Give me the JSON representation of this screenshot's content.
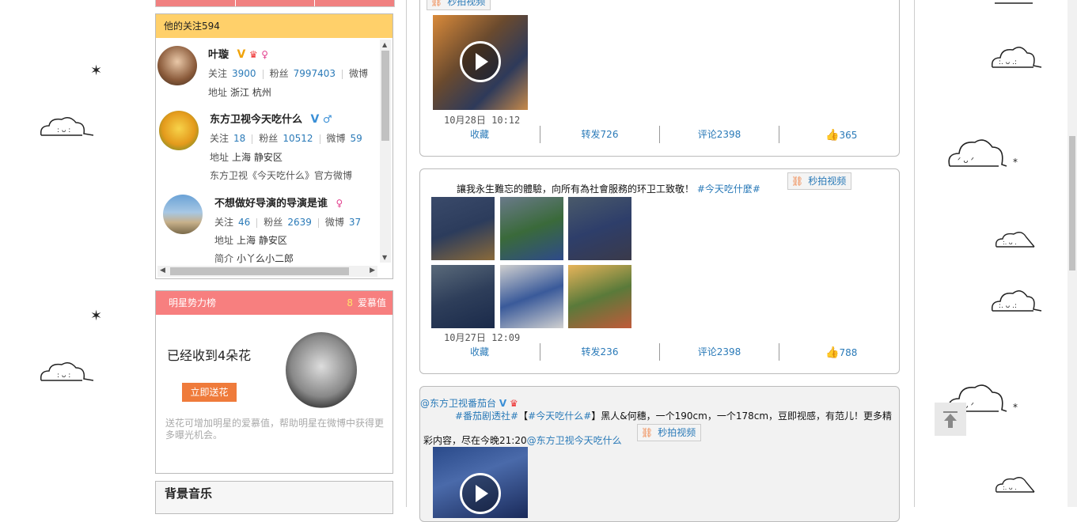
{
  "left": {
    "following": {
      "header": "他的关注594",
      "items": [
        {
          "name": "叶璇",
          "follow_label": "关注",
          "follow": "3900",
          "fans_label": "粉丝",
          "fans": "7997403",
          "weibo_label": "微博",
          "addr_label": "地址",
          "addr": "浙江 杭州"
        },
        {
          "name": "东方卫视今天吃什么",
          "follow_label": "关注",
          "follow": "18",
          "fans_label": "粉丝",
          "fans": "10512",
          "weibo_label": "微博",
          "weibo": "59",
          "addr_label": "地址",
          "addr": "上海 静安区",
          "desc": "东方卫视《今天吃什么》官方微博"
        },
        {
          "name": "不想做好导演的导演是谁",
          "follow_label": "关注",
          "follow": "46",
          "fans_label": "粉丝",
          "fans": "2639",
          "weibo_label": "微博",
          "weibo": "37",
          "addr_label": "地址",
          "addr": "上海 静安区",
          "intro_label": "简介",
          "intro": "小丫么小二郎"
        }
      ]
    },
    "star_panel": {
      "title": "明星势力榜",
      "count": "8",
      "count_label": "爱慕值",
      "flowers": "已经收到4朵花",
      "send_button": "立即送花",
      "desc": "送花可增加明星的爱慕值，帮助明星在微博中获得更多曝光机会。"
    },
    "music": {
      "title": "背景音乐"
    }
  },
  "feed": {
    "post1": {
      "video_btn": "秒拍视频",
      "time": "10月28日 10:12",
      "actions": {
        "collect": "收藏",
        "repost": "转发726",
        "comment": "评论2398",
        "likes": "365"
      }
    },
    "post2": {
      "text": "讓我永生難忘的體驗，向所有為社會服務的环卫工致敬！",
      "tag": "#今天吃什麼#",
      "video_btn": "秒拍视频",
      "time": "10月27日 12:09",
      "actions": {
        "collect": "收藏",
        "repost": "转发236",
        "comment": "评论2398",
        "likes": "788"
      }
    },
    "post3": {
      "author": "@东方卫视番茄台",
      "tag1": "#番茄剧透社#",
      "bracket_open": "【",
      "tag2": "#今天吃什么#",
      "text1": "】黑人&何穗，一个190cm，一个178cm，豆即视感，有范儿！更多精",
      "text2": "彩内容，尽在今晚21:20",
      "mention": "@东方卫视今天吃什么",
      "video_btn": "秒拍视频"
    }
  },
  "colors": {
    "accent_link": "#2a7ab8",
    "header_yellow": "#ffd06a",
    "header_red": "#f77f7f",
    "orange_button": "#ef7b3b"
  }
}
